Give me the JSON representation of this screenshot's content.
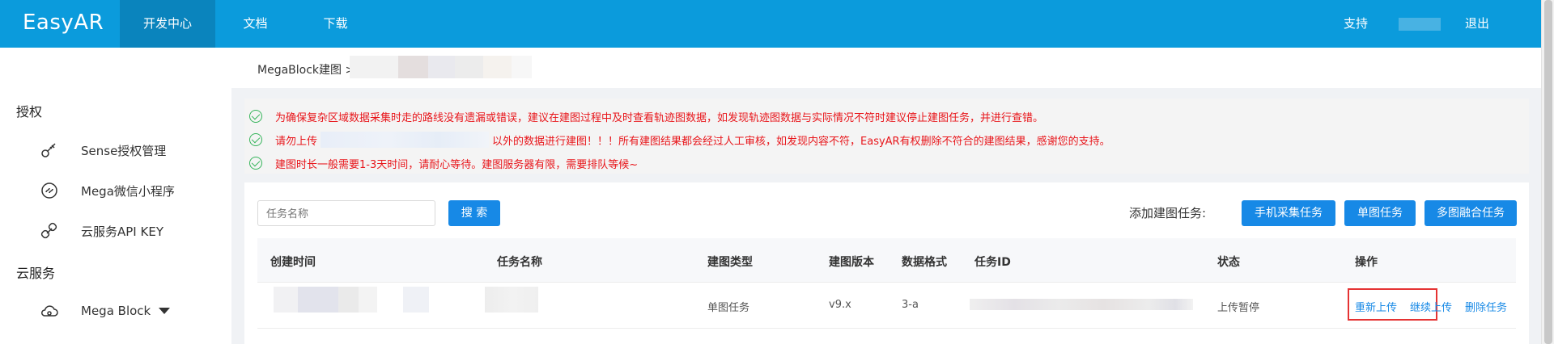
{
  "header": {
    "logo": "EasyAR",
    "nav": [
      {
        "label": "开发中心",
        "active": true
      },
      {
        "label": "文档",
        "active": false
      },
      {
        "label": "下载",
        "active": false
      }
    ],
    "support": "支持",
    "logout": "退出"
  },
  "sidebar": {
    "group_auth": "授权",
    "items_auth": [
      {
        "label": "Sense授权管理",
        "icon": "key-icon"
      },
      {
        "label": "Mega微信小程序",
        "icon": "mini-program-icon"
      },
      {
        "label": "云服务API KEY",
        "icon": "link-key-icon"
      }
    ],
    "group_cloud": "云服务",
    "mega_block": "Mega Block"
  },
  "breadcrumb": {
    "root": "MegaBlock建图 >"
  },
  "notices": {
    "line1": "为确保复杂区域数据采集时走的路线没有遗漏或错误，建议在建图过程中及时查看轨迹图数据，如发现轨迹图数据与实际情况不符时建议停止建图任务，并进行查错。",
    "line2_pre": "请勿上传",
    "line2_post": "以外的数据进行建图！！！所有建图结果都会经过人工审核，如发现内容不符，EasyAR有权删除不符合的建图结果，感谢您的支持。",
    "line3": "建图时长一般需要1-3天时间，请耐心等待。建图服务器有限，需要排队等候~"
  },
  "toolbar": {
    "search_placeholder": "任务名称",
    "search_button": "搜 索",
    "add_label": "添加建图任务:",
    "btn_mobile": "手机采集任务",
    "btn_single": "单图任务",
    "btn_multi": "多图融合任务"
  },
  "table": {
    "headers": [
      "创建时间",
      "任务名称",
      "建图类型",
      "建图版本",
      "数据格式",
      "任务ID",
      "状态",
      "操作"
    ],
    "row": {
      "type": "单图任务",
      "version": "v9.x",
      "format": "3-a",
      "status": "上传暂停",
      "actions": [
        "重新上传",
        "继续上传",
        "删除任务"
      ]
    }
  },
  "colors": {
    "header_bg": "#0b9bdc",
    "primary": "#1789e6",
    "notice_red": "#e8161b",
    "check_green": "#35b45a",
    "highlight_red": "#e53333"
  }
}
